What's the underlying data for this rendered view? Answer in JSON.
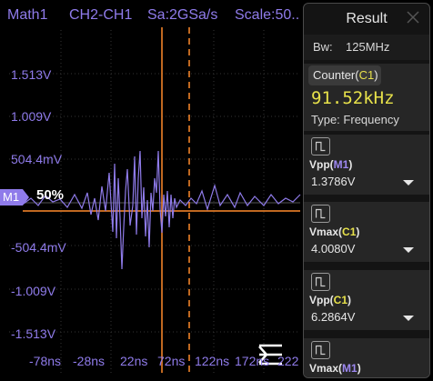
{
  "header": {
    "math": "Math1",
    "channels": "CH2-CH1",
    "sample_rate": "Sa:2GSa/s",
    "scale": "Scale:50.."
  },
  "y_axis": {
    "ticks": [
      "1.513V",
      "1.009V",
      "504.4mV",
      "-504.4mV",
      "-1.009V",
      "-1.513V"
    ]
  },
  "x_axis": {
    "ticks": [
      "-78ns",
      "-28ns",
      "22ns",
      "72ns",
      "122ns",
      "172ns",
      "222"
    ]
  },
  "marker": {
    "label": "M1",
    "level": "50%"
  },
  "colors": {
    "trace": "#8f7bea",
    "cursor": "#ff8a2a",
    "value_yellow": "#e7e14a",
    "panel": "#141414"
  },
  "icons": {
    "menu": "menu-collapse-icon",
    "close": "close-icon",
    "card": "waveform-icon",
    "dropdown": "dropdown-arrow-icon"
  },
  "panel": {
    "title": "Result",
    "bw_label": "Bw:",
    "bw_value": "125MHz",
    "counter": {
      "label": "Counter(",
      "channel": "C1",
      "label_end": ")",
      "value": "91.52kHz",
      "type_label": "Type:",
      "type_value": "Frequency"
    },
    "measurements": [
      {
        "name": "Vpp(",
        "channel": "M1",
        "end": ")",
        "value": "1.3786V"
      },
      {
        "name": "Vmax(",
        "channel": "C1",
        "end": ")",
        "value": "4.0080V"
      },
      {
        "name": "Vpp(",
        "channel": "C1",
        "end": ")",
        "value": "6.2864V"
      },
      {
        "name": "Vmax(",
        "channel": "M1",
        "end": ")",
        "value": ""
      }
    ]
  }
}
